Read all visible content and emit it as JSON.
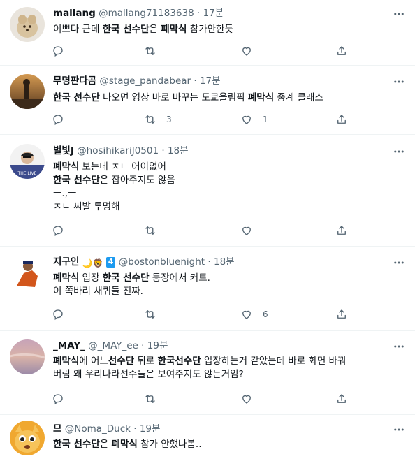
{
  "tweets": [
    {
      "name": "mallang",
      "handle": "@mallang71183638",
      "sep": "·",
      "time": "17분",
      "body": [
        {
          "text": "이쁘다 근데 ",
          "bold": false
        },
        {
          "text": "한국 선수단",
          "bold": true
        },
        {
          "text": "은 ",
          "bold": false
        },
        {
          "text": "폐막식",
          "bold": true
        },
        {
          "text": " 참가안한듯",
          "bold": false
        }
      ],
      "retweets": "",
      "likes": "",
      "replies": ""
    },
    {
      "name": "무명판다곰",
      "handle": "@stage_pandabear",
      "sep": "·",
      "time": "17분",
      "body": [
        {
          "text": "한국 선수단",
          "bold": true
        },
        {
          "text": " 나오면 영상 바로 바꾸는 도쿄올림픽 ",
          "bold": false
        },
        {
          "text": "폐막식",
          "bold": true
        },
        {
          "text": " 중계 클래스",
          "bold": false
        }
      ],
      "retweets": "3",
      "likes": "1",
      "replies": ""
    },
    {
      "name": "별빛J",
      "handle": "@hosihikariJ0501",
      "sep": "·",
      "time": "18분",
      "body": [
        {
          "text": "폐막식",
          "bold": true
        },
        {
          "text": " 보는데 ㅈㄴ 어이없어\n",
          "bold": false
        },
        {
          "text": "한국 선수단",
          "bold": true
        },
        {
          "text": "은 잡아주지도 않음\nㅡ.,ㅡ\nㅈㄴ 씨발 투명해",
          "bold": false
        }
      ],
      "retweets": "",
      "likes": "",
      "replies": ""
    },
    {
      "name": "지구인",
      "emoji": "🌙🦁",
      "number_badge": "4",
      "handle": "@bostonbluenight",
      "sep": "·",
      "time": "18분",
      "body": [
        {
          "text": "폐막식",
          "bold": true
        },
        {
          "text": " 입장 ",
          "bold": false
        },
        {
          "text": "한국 선수단",
          "bold": true
        },
        {
          "text": " 등장에서 커트.\n이 쪽바리 새퀴들 진짜.",
          "bold": false
        }
      ],
      "retweets": "",
      "likes": "6",
      "replies": ""
    },
    {
      "name": "_MAY_",
      "handle": "@_MAY_ee",
      "sep": "·",
      "time": "19분",
      "body": [
        {
          "text": "폐막식",
          "bold": true
        },
        {
          "text": "에 어느",
          "bold": false
        },
        {
          "text": "선수단",
          "bold": true
        },
        {
          "text": " 뒤로 ",
          "bold": false
        },
        {
          "text": "한국선수단",
          "bold": true
        },
        {
          "text": " 입장하는거 같았는데 바로 화면 바꿔\n버림 왜 우리나라선수들은 보여주지도 않는거임?",
          "bold": false
        }
      ],
      "retweets": "",
      "likes": "",
      "replies": ""
    },
    {
      "name": "므",
      "handle": "@Noma_Duck",
      "sep": "·",
      "time": "19분",
      "body": [
        {
          "text": "한국 선수단",
          "bold": true
        },
        {
          "text": "은 ",
          "bold": false
        },
        {
          "text": "폐막식",
          "bold": true
        },
        {
          "text": " 참가 안했나봄..",
          "bold": false
        }
      ],
      "retweets": "",
      "likes": "",
      "replies": ""
    }
  ],
  "colors": {
    "text": "#0f1419",
    "secondary": "#536471",
    "divider": "#eff3f4",
    "accent": "#1d9bf0"
  },
  "icons": {
    "reply": "reply-icon",
    "retweet": "retweet-icon",
    "like": "like-icon",
    "share": "share-icon",
    "more": "more-icon"
  }
}
